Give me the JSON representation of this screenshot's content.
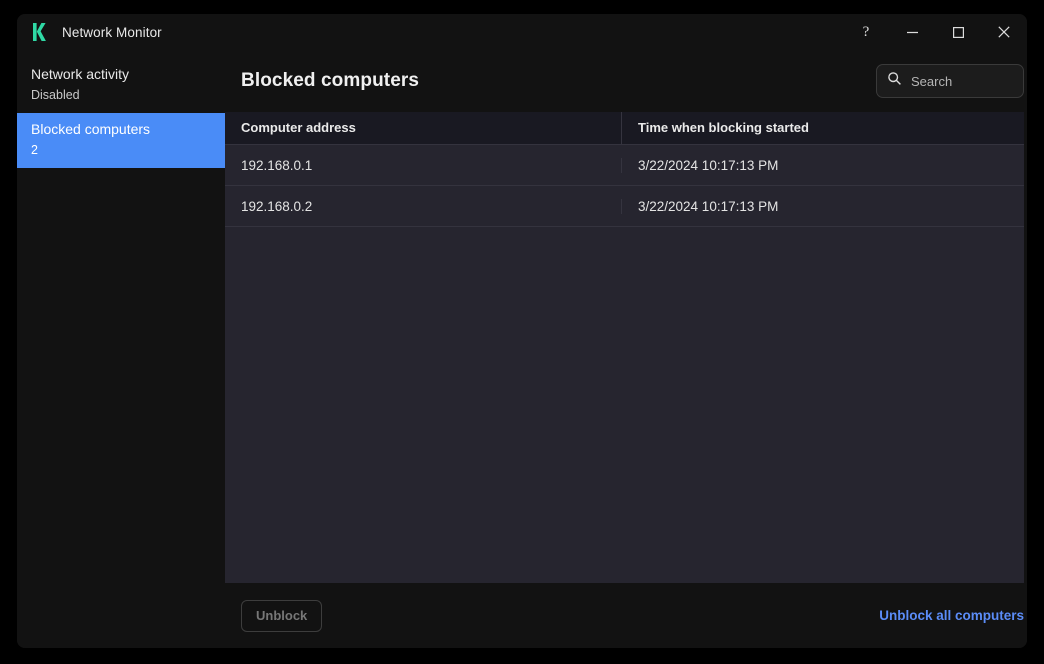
{
  "window": {
    "title": "Network Monitor",
    "logo_icon": "kaspersky-k-logo",
    "accent_color": "#2fd9a5",
    "controls": {
      "help": "?",
      "minimize": "minimize-icon",
      "maximize": "maximize-icon",
      "close": "close-icon"
    }
  },
  "sidebar": {
    "items": [
      {
        "label": "Network activity",
        "sub": "Disabled",
        "selected": false
      },
      {
        "label": "Blocked computers",
        "sub": "2",
        "selected": true
      }
    ],
    "selected_color": "#4a8cf7"
  },
  "main": {
    "title": "Blocked computers",
    "search": {
      "placeholder": "Search",
      "value": "",
      "icon": "search-icon"
    },
    "table": {
      "columns": [
        "Computer address",
        "Time when blocking started"
      ],
      "rows": [
        {
          "address": "192.168.0.1",
          "time": "3/22/2024 10:17:13 PM"
        },
        {
          "address": "192.168.0.2",
          "time": "3/22/2024 10:17:13 PM"
        }
      ]
    }
  },
  "footer": {
    "unblock_button": "Unblock",
    "unblock_all_link": "Unblock all computers",
    "link_color": "#5b8cf7"
  }
}
